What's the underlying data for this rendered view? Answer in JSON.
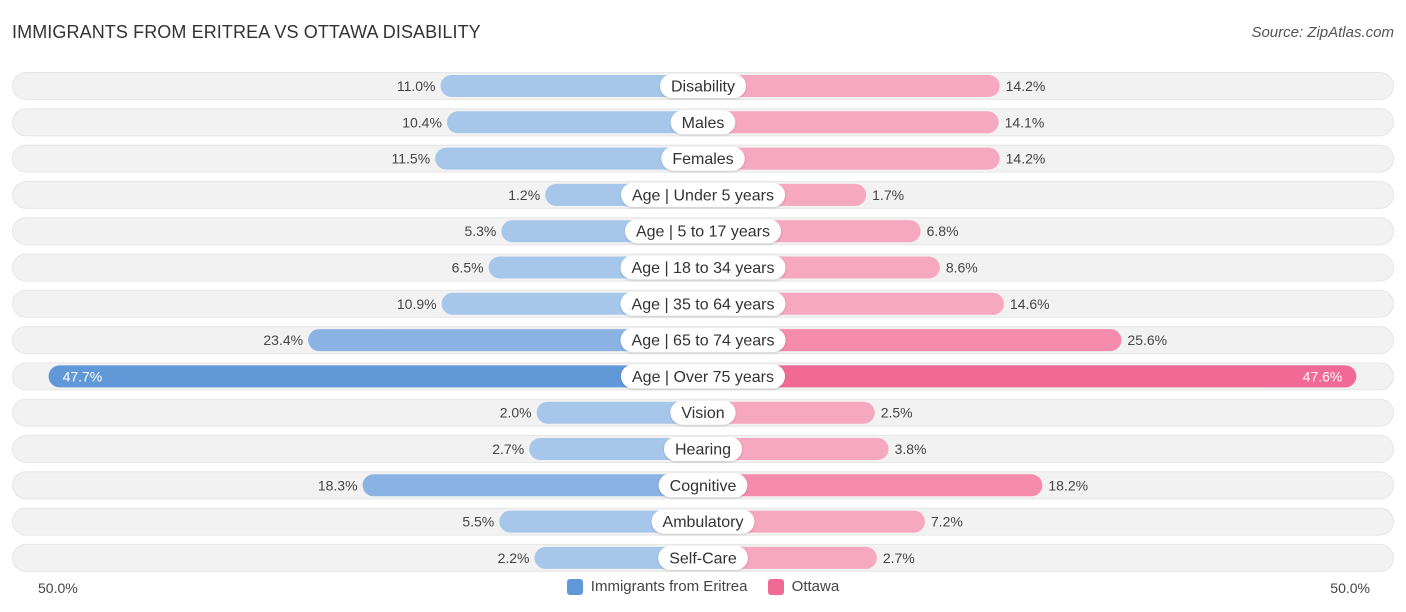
{
  "header": {
    "title": "IMMIGRANTS FROM ERITREA VS OTTAWA DISABILITY",
    "source": "Source: ZipAtlas.com"
  },
  "colors": {
    "left_light": "#a7c7ea",
    "left_strong": "#6199d8",
    "right_light": "#f5a8c0",
    "right_strong": "#f06a95",
    "row_bg": "#f2f2f2"
  },
  "axis": {
    "left_label": "50.0%",
    "right_label": "50.0%"
  },
  "legend": [
    {
      "label": "Immigrants from Eritrea",
      "color": "#6199d8"
    },
    {
      "label": "Ottawa",
      "color": "#f06a95"
    }
  ],
  "chart_data": {
    "type": "bar",
    "orientation": "horizontal-diverging",
    "title": "IMMIGRANTS FROM ERITREA VS OTTAWA DISABILITY",
    "xlabel": "",
    "ylabel": "",
    "xlim": [
      -50,
      50
    ],
    "categories": [
      "Disability",
      "Males",
      "Females",
      "Age | Under 5 years",
      "Age | 5 to 17 years",
      "Age | 18 to 34 years",
      "Age | 35 to 64 years",
      "Age | 65 to 74 years",
      "Age | Over 75 years",
      "Vision",
      "Hearing",
      "Cognitive",
      "Ambulatory",
      "Self-Care"
    ],
    "series": [
      {
        "name": "Immigrants from Eritrea",
        "side": "left",
        "values": [
          11.0,
          10.4,
          11.5,
          1.2,
          5.3,
          6.5,
          10.9,
          23.4,
          47.7,
          2.0,
          2.7,
          18.3,
          5.5,
          2.2
        ],
        "labels": [
          "11.0%",
          "10.4%",
          "11.5%",
          "1.2%",
          "5.3%",
          "6.5%",
          "10.9%",
          "23.4%",
          "47.7%",
          "2.0%",
          "2.7%",
          "18.3%",
          "5.5%",
          "2.2%"
        ]
      },
      {
        "name": "Ottawa",
        "side": "right",
        "values": [
          14.2,
          14.1,
          14.2,
          1.7,
          6.8,
          8.6,
          14.6,
          25.6,
          47.6,
          2.5,
          3.8,
          18.2,
          7.2,
          2.7
        ],
        "labels": [
          "14.2%",
          "14.1%",
          "14.2%",
          "1.7%",
          "6.8%",
          "8.6%",
          "14.6%",
          "25.6%",
          "47.6%",
          "2.5%",
          "3.8%",
          "18.2%",
          "7.2%",
          "2.7%"
        ]
      }
    ],
    "legend_position": "bottom-center",
    "grid": false
  }
}
